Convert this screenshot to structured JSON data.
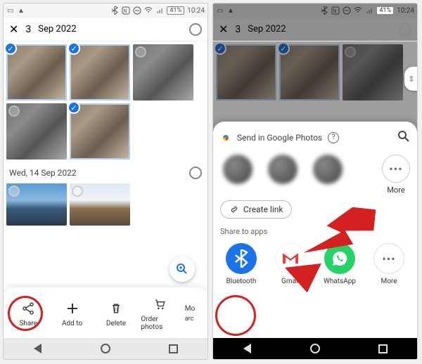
{
  "status": {
    "battery": "41%",
    "time": "10:24"
  },
  "header": {
    "count": "3",
    "date_frag": "Sep 2022"
  },
  "section_date": "Wed, 14 Sep 2022",
  "actions": {
    "share": "Share",
    "add_to": "Add to",
    "delete": "Delete",
    "order": "Order photos",
    "more_cut": "Mo",
    "more_cut2": "arc"
  },
  "sheet": {
    "title": "Send in Google Photos",
    "more": "More",
    "create_link": "Create link",
    "share_to_apps": "Share to apps",
    "apps": {
      "bluetooth": "Bluetooth",
      "gmail": "Gmail",
      "whatsapp": "WhatsApp",
      "more": "More"
    }
  }
}
